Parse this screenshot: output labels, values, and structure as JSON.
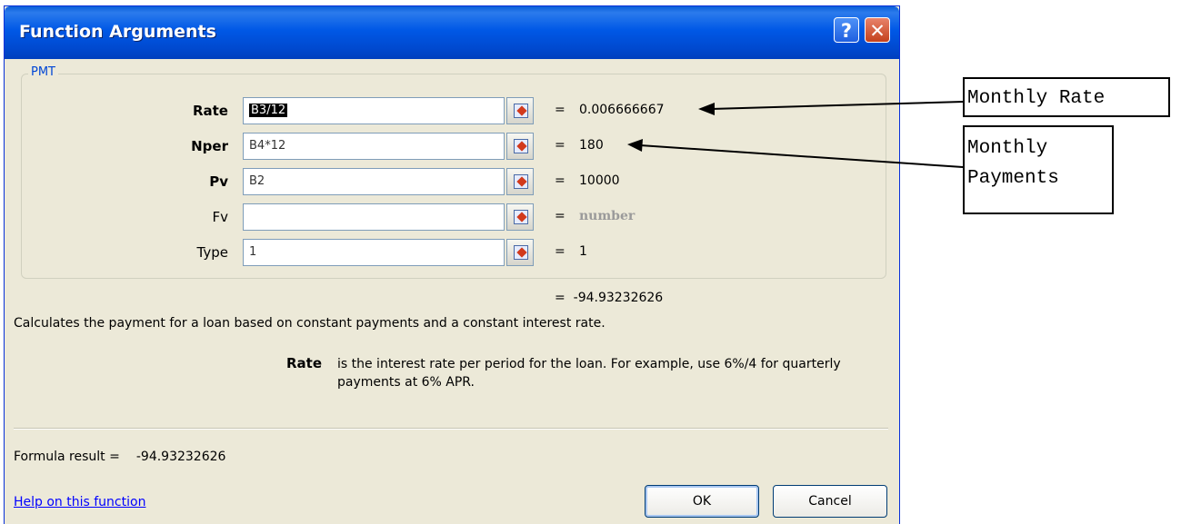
{
  "window": {
    "title": "Function Arguments",
    "help_glyph": "?",
    "close_glyph": "✕"
  },
  "group": {
    "label": "PMT"
  },
  "args": [
    {
      "label": "Rate",
      "required": true,
      "input": "B3/12",
      "equals": "=",
      "value": "0.006666667"
    },
    {
      "label": "Nper",
      "required": true,
      "input": "B4*12",
      "equals": "=",
      "value": "180"
    },
    {
      "label": "Pv",
      "required": true,
      "input": "B2",
      "equals": "=",
      "value": "10000"
    },
    {
      "label": "Fv",
      "required": false,
      "input": "",
      "equals": "=",
      "value": "number"
    },
    {
      "label": "Type",
      "required": false,
      "input": "1",
      "equals": "=",
      "value": "1"
    }
  ],
  "result": {
    "equals": "=",
    "value": "-94.93232626"
  },
  "description": "Calculates the payment for a loan based on constant payments and a constant interest rate.",
  "arg_help": {
    "name": "Rate",
    "text": "is the interest rate per period for the loan. For example, use 6%/4 for quarterly payments at 6% APR."
  },
  "formula_result": {
    "label": "Formula result =",
    "value": "-94.93232626"
  },
  "help_link": "Help on this function",
  "buttons": {
    "ok": "OK",
    "cancel": "Cancel"
  },
  "annotations": {
    "monthly_rate": "Monthly Rate",
    "monthly_payments_line1": "Monthly",
    "monthly_payments_line2": "Payments"
  }
}
